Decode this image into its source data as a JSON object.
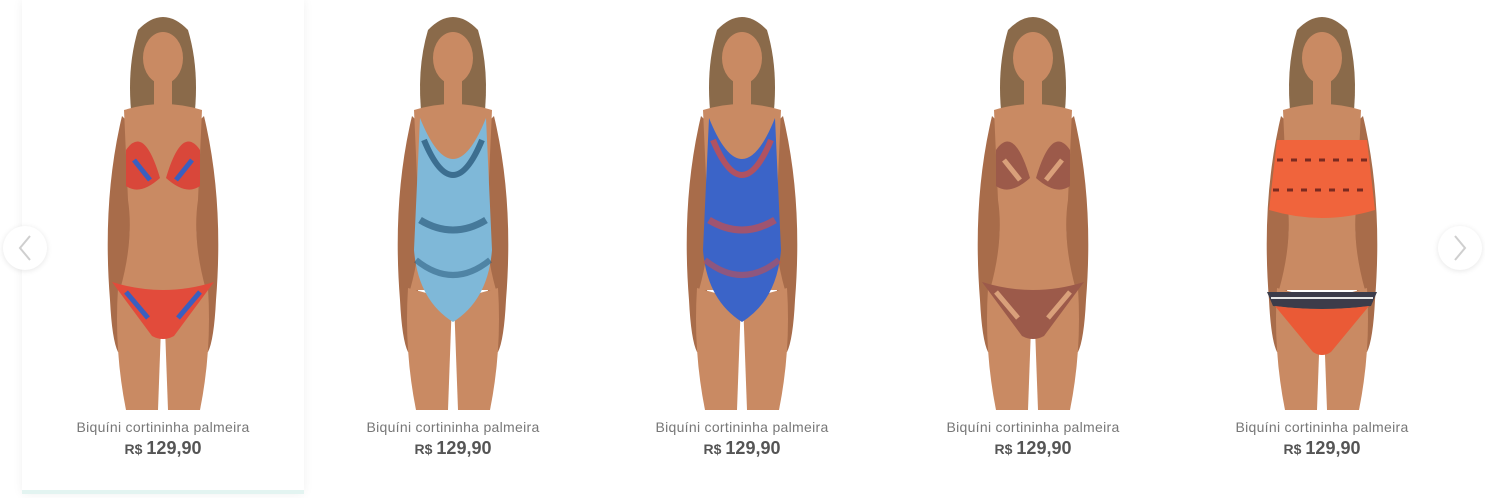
{
  "carousel": {
    "prev_icon": "chevron-left-icon",
    "next_icon": "chevron-right-icon",
    "products": [
      {
        "name": "Biquíni cortininha palmeira",
        "currency": "R$",
        "price": "129,90",
        "type": "bikini",
        "top_color": "#d9473a",
        "bottom_color": "#e24b3b",
        "accent": "#3a5fc0"
      },
      {
        "name": "Biquíni cortininha palmeira",
        "currency": "R$",
        "price": "129,90",
        "type": "swimsuit",
        "top_color": "#7fb8d8",
        "bottom_color": "#7fb8d8",
        "accent": "#1f4f72"
      },
      {
        "name": "Biquíni cortininha palmeira",
        "currency": "R$",
        "price": "129,90",
        "type": "swimsuit",
        "top_color": "#3b64c8",
        "bottom_color": "#3b64c8",
        "accent": "#e24a35"
      },
      {
        "name": "Biquíni cortininha palmeira",
        "currency": "R$",
        "price": "129,90",
        "type": "bikini",
        "top_color": "#9c5a4a",
        "bottom_color": "#9c5a4a",
        "accent": "#d9a07a"
      },
      {
        "name": "Biquíni cortininha palmeira",
        "currency": "R$",
        "price": "129,90",
        "type": "flounce",
        "top_color": "#f0643c",
        "bottom_color": "#ea5a36",
        "accent": "#7a2a20"
      }
    ]
  }
}
